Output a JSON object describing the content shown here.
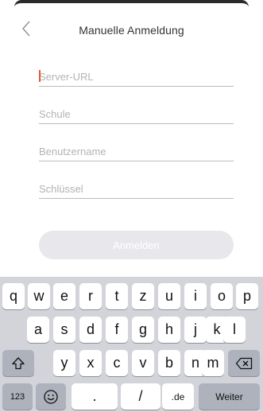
{
  "header": {
    "title": "Manuelle Anmeldung",
    "back_icon": "chevron-left-icon"
  },
  "form": {
    "server_url": {
      "placeholder": "Server-URL",
      "value": ""
    },
    "school": {
      "placeholder": "Schule",
      "value": ""
    },
    "username": {
      "placeholder": "Benutzername",
      "value": ""
    },
    "key": {
      "placeholder": "Schlüssel",
      "value": ""
    },
    "login_label": "Anmelden"
  },
  "keyboard": {
    "row1": [
      "q",
      "w",
      "e",
      "r",
      "t",
      "z",
      "u",
      "i",
      "o",
      "p"
    ],
    "row2": [
      "a",
      "s",
      "d",
      "f",
      "g",
      "h",
      "j",
      "k",
      "l"
    ],
    "row3": [
      "y",
      "x",
      "c",
      "v",
      "b",
      "n",
      "m"
    ],
    "shift_icon": "shift-icon",
    "backspace_icon": "backspace-icon",
    "numbers_label": "123",
    "emoji_icon": "emoji-icon",
    "period_label": ".",
    "slash_label": "/",
    "domain_label": ".de",
    "return_label": "Weiter"
  },
  "colors": {
    "caret": "#e05a3a",
    "button_disabled": "#e8e8ec",
    "keyboard_bg": "#d2d4da"
  }
}
